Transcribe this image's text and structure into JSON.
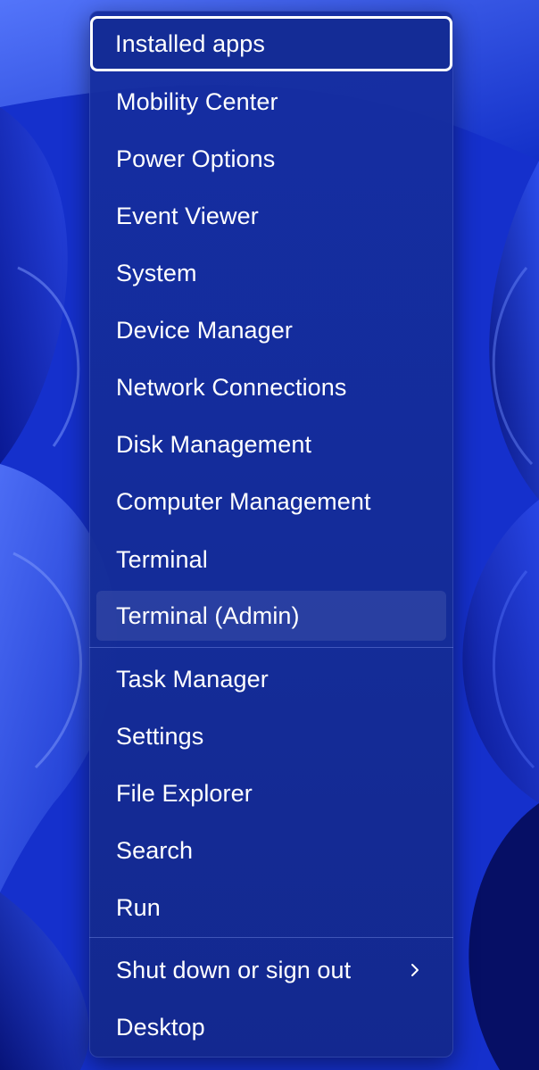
{
  "menu": {
    "items": [
      {
        "label": "Installed apps",
        "state": "focused"
      },
      {
        "label": "Mobility Center"
      },
      {
        "label": "Power Options"
      },
      {
        "label": "Event Viewer"
      },
      {
        "label": "System"
      },
      {
        "label": "Device Manager"
      },
      {
        "label": "Network Connections"
      },
      {
        "label": "Disk Management"
      },
      {
        "label": "Computer Management"
      },
      {
        "label": "Terminal"
      },
      {
        "label": "Terminal (Admin)",
        "state": "hover"
      },
      {
        "label": "Task Manager"
      },
      {
        "label": "Settings"
      },
      {
        "label": "File Explorer"
      },
      {
        "label": "Search"
      },
      {
        "label": "Run"
      },
      {
        "label": "Shut down or sign out",
        "submenu_icon": "chevron-right-icon"
      },
      {
        "label": "Desktop"
      }
    ]
  },
  "colors": {
    "menu_background": "#142c96",
    "text": "#ffffff",
    "wallpaper_primary": "#1833d6",
    "wallpaper_dark": "#081690"
  }
}
